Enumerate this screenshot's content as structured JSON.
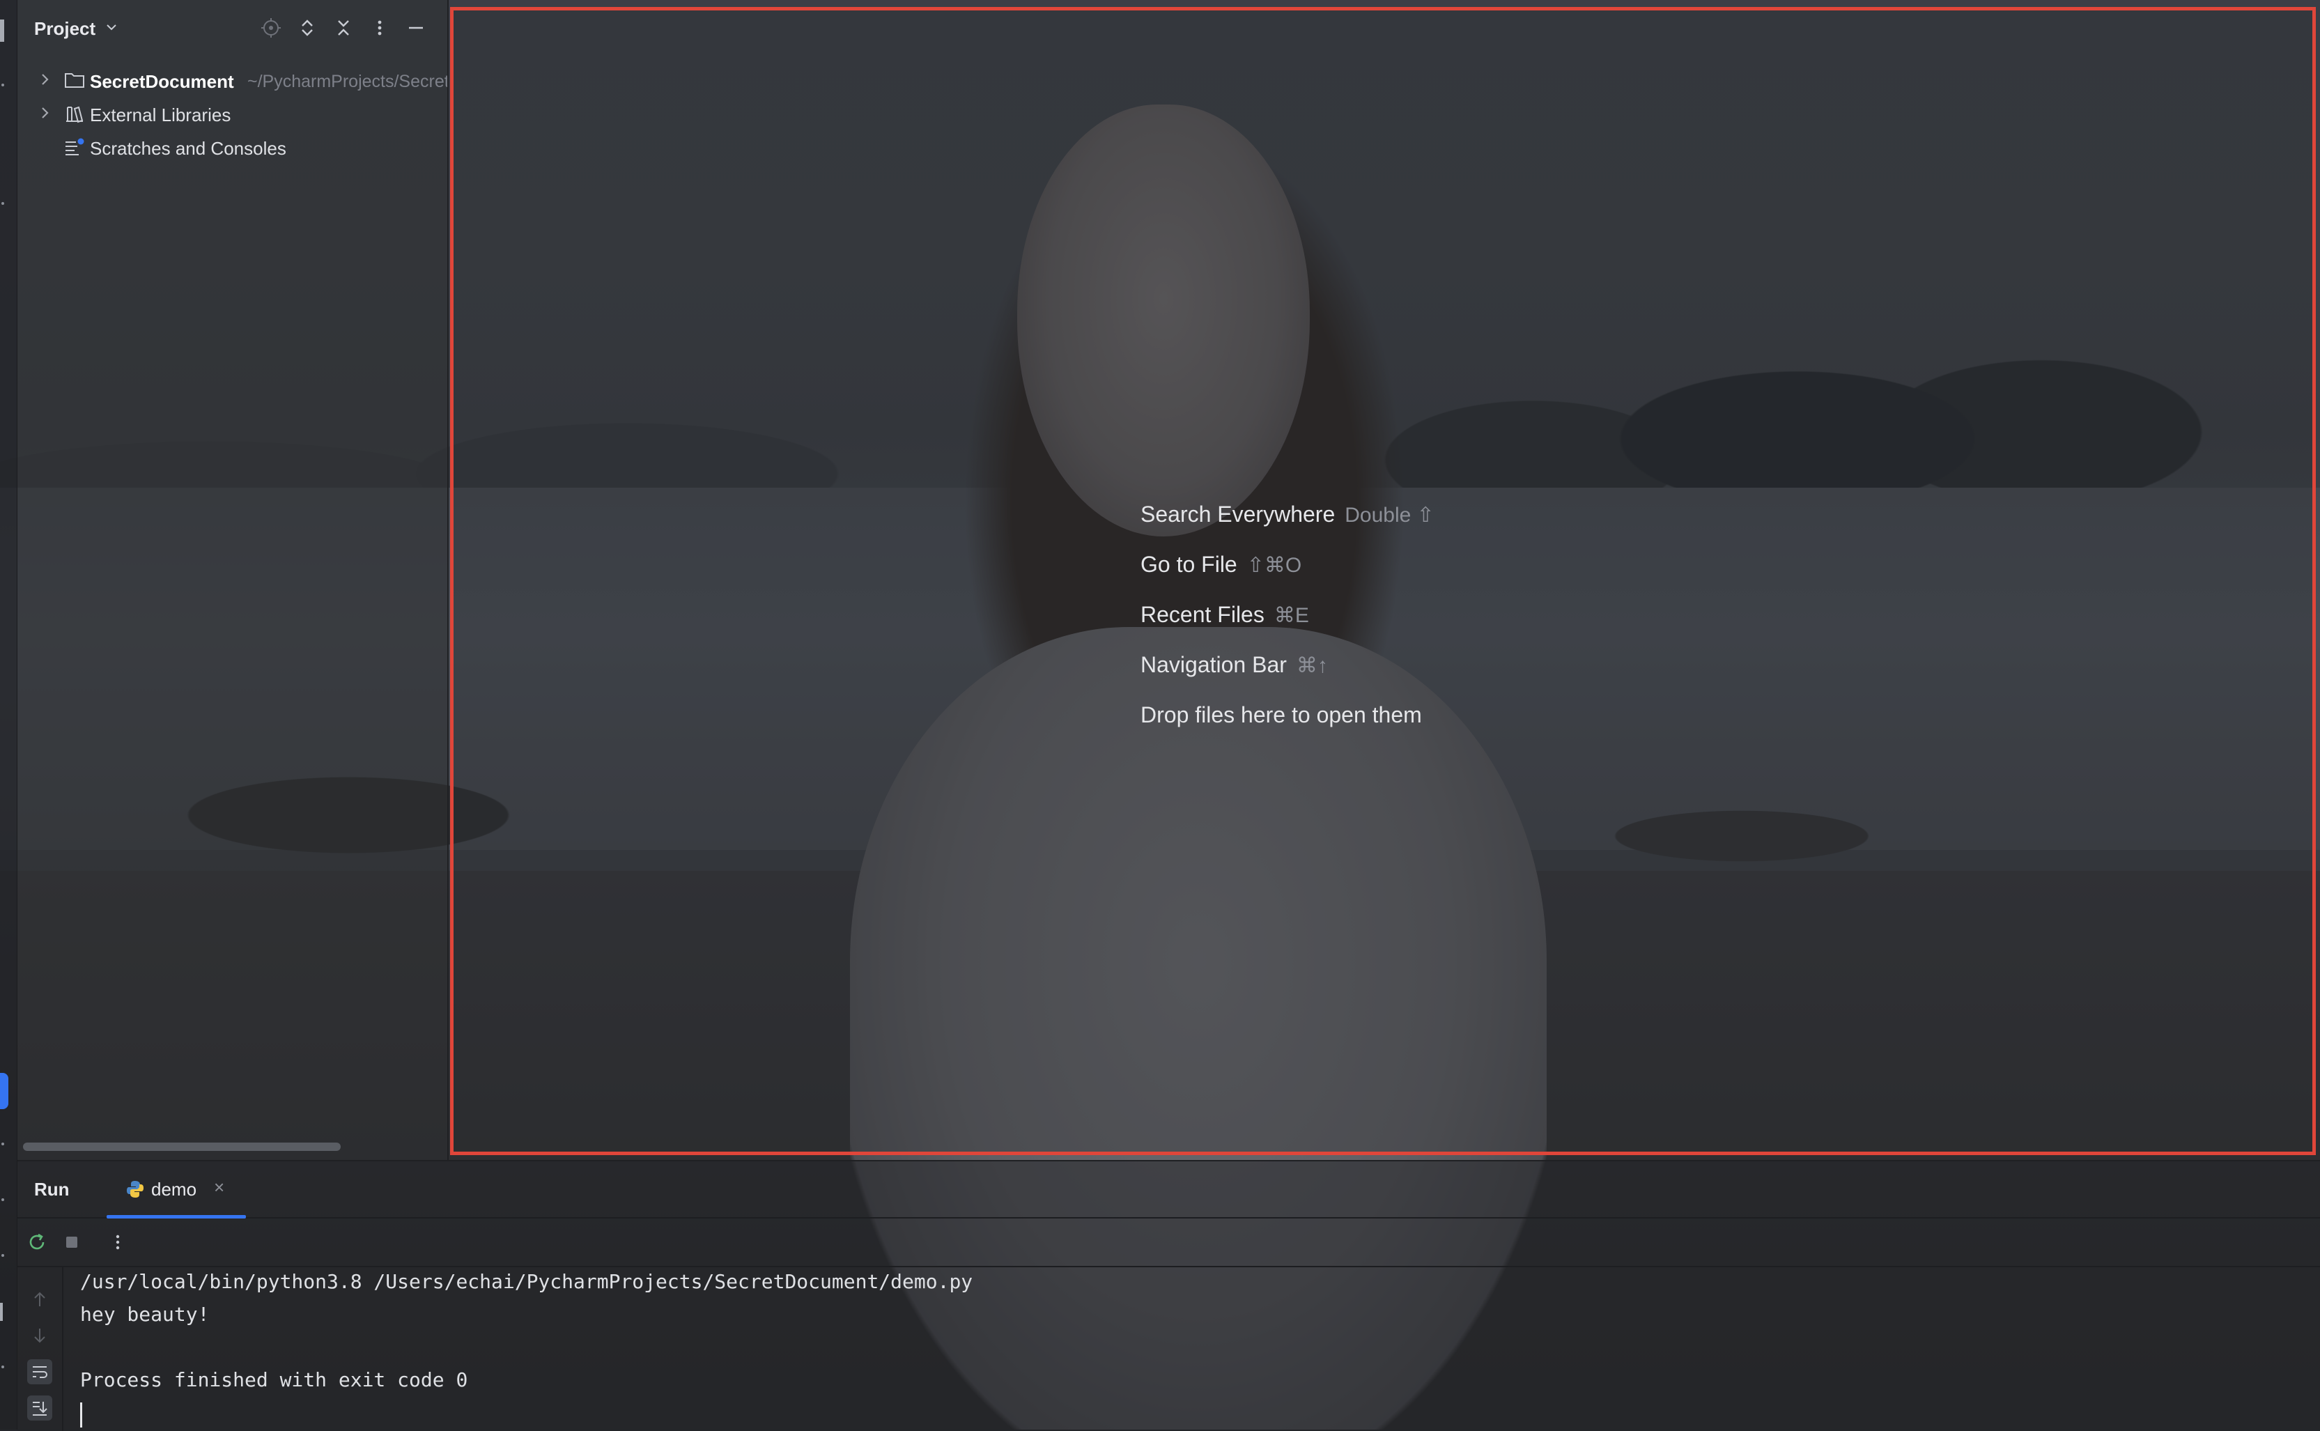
{
  "project_panel": {
    "title": "Project",
    "tree": [
      {
        "label": "SecretDocument",
        "path": "~/PycharmProjects/SecretDocument",
        "icon": "folder-icon"
      },
      {
        "label": "External Libraries",
        "icon": "library-icon"
      },
      {
        "label": "Scratches and Consoles",
        "icon": "scratches-icon"
      }
    ]
  },
  "editor": {
    "hints": [
      {
        "label": "Search Everywhere",
        "shortcut": "Double ⇧"
      },
      {
        "label": "Go to File",
        "shortcut": "⇧⌘O"
      },
      {
        "label": "Recent Files",
        "shortcut": "⌘E"
      },
      {
        "label": "Navigation Bar",
        "shortcut": "⌘↑"
      },
      {
        "label": "Drop files here to open them",
        "shortcut": ""
      }
    ]
  },
  "run": {
    "title": "Run",
    "tab_label": "demo",
    "console_lines": [
      "/usr/local/bin/python3.8 /Users/echai/PycharmProjects/SecretDocument/demo.py",
      "hey beauty!",
      "",
      "Process finished with exit code 0"
    ]
  },
  "colors": {
    "accent": "#3574f0",
    "highlight_border": "#e0463a",
    "panel_text": "#dfe1e5",
    "muted_text": "#7d8089"
  }
}
